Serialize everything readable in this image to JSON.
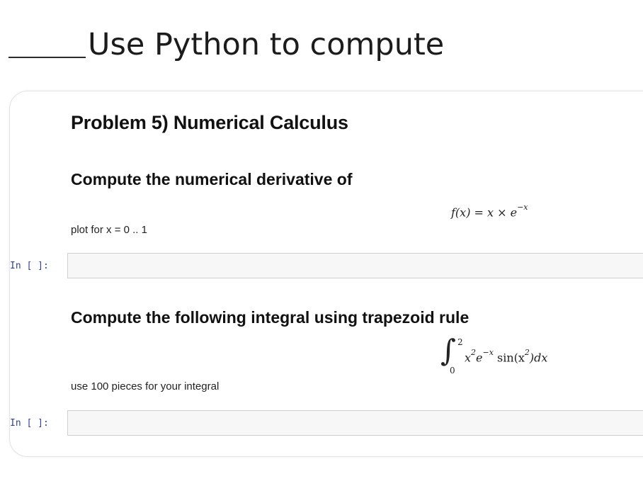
{
  "header": {
    "title": "Use Python to compute"
  },
  "notebook": {
    "problem_title": "Problem 5) Numerical Calculus",
    "section1": {
      "heading": "Compute the numerical derivative of",
      "formula": "f(x) = x × e",
      "exponent": "−x",
      "note": "plot for x = 0 .. 1",
      "prompt": "In [ ]:",
      "cell_value": ""
    },
    "section2": {
      "heading": "Compute the following integral using trapezoid rule",
      "upper_limit": "2",
      "lower_limit": "0",
      "integrand_x": "x",
      "integrand_x_exp": "2",
      "integrand_e": "e",
      "integrand_e_exp": "−x",
      "integrand_sin": " sin(x",
      "integrand_sin_exp": "2",
      "integrand_tail": ")dx",
      "note": "use 100 pieces for your integral",
      "prompt": "In [ ]:",
      "cell_value": ""
    }
  }
}
